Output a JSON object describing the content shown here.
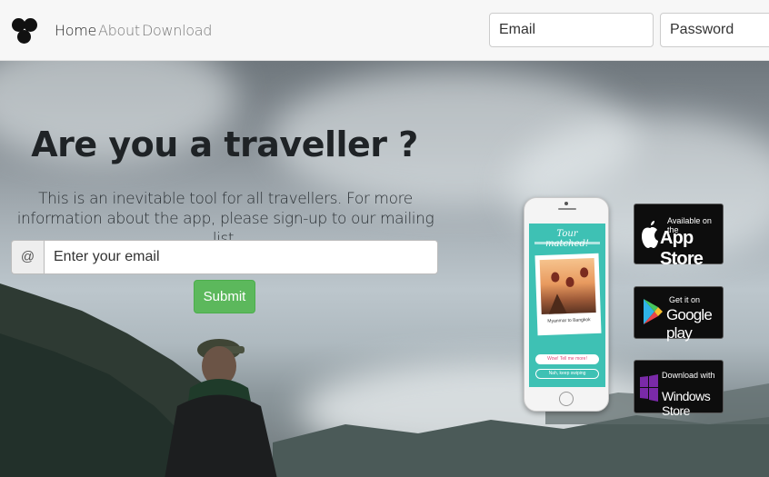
{
  "navbar": {
    "links": [
      {
        "label": "Home",
        "active": true
      },
      {
        "label": "About",
        "active": false
      },
      {
        "label": "Download",
        "active": false
      }
    ],
    "email_placeholder": "Email",
    "password_placeholder": "Password"
  },
  "hero": {
    "title": "Are you a traveller ?",
    "text": "This is an inevitable tool for all travellers. For more information about the app, please sign-up to our mailing list.",
    "addon": "@",
    "email_placeholder": "Enter your email",
    "submit_label": "Submit"
  },
  "phone": {
    "screen_title": "Tour matched!",
    "caption": "Myanmar to Bangkok",
    "button_primary": "Wow! Tell me more!",
    "button_secondary": "Nah, keep swiping"
  },
  "badges": [
    {
      "small": "Available on the",
      "big": "App Store",
      "icon": "apple-icon"
    },
    {
      "small": "Get it on",
      "big": "Google play",
      "icon": "google-play-icon"
    },
    {
      "small": "Download with",
      "big": "Windows Store",
      "icon": "windows-icon"
    }
  ],
  "colors": {
    "submit": "#5cb85c",
    "phone_screen": "#3ec1b4",
    "navbar_bg": "#f7f7f7"
  }
}
